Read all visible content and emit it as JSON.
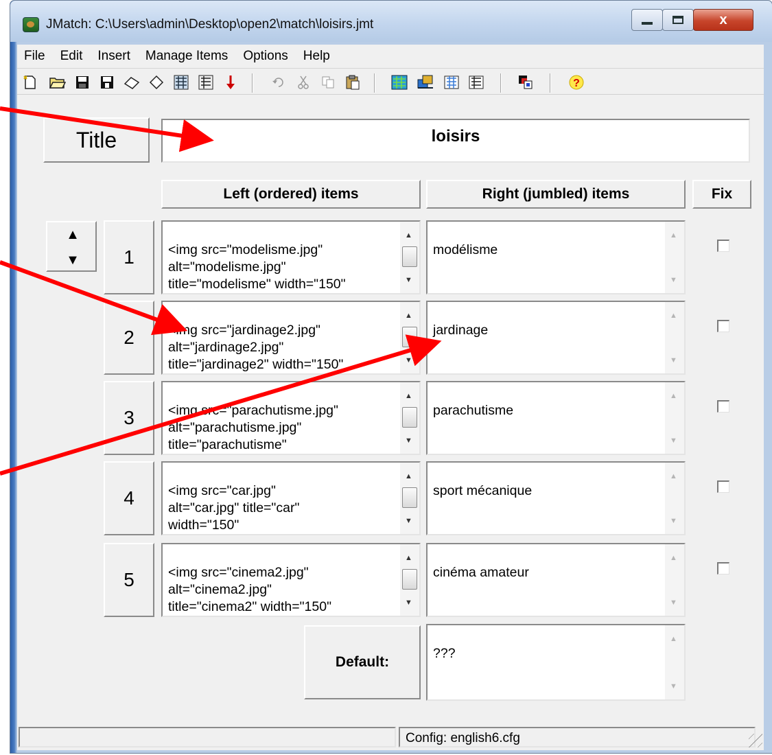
{
  "window": {
    "title": "JMatch: C:\\Users\\admin\\Desktop\\open2\\match\\loisirs.jmt",
    "controls": {
      "minimize": "minimize",
      "maximize": "maximize",
      "close": "x"
    }
  },
  "menu": [
    "File",
    "Edit",
    "Insert",
    "Manage Items",
    "Options",
    "Help"
  ],
  "toolbar": {
    "icons": [
      "new-file-icon",
      "open-folder-icon",
      "save-icon",
      "save-as-icon",
      "eraser-icon",
      "add-exercise-icon",
      "exercise-icon",
      "arrow-down-icon",
      "undo-icon",
      "cut-icon",
      "copy-icon",
      "paste-icon",
      "web-page-icon",
      "export-icon",
      "hotpot-icon",
      "drag-drop-icon",
      "config-icon",
      "help-icon"
    ]
  },
  "title_section": {
    "button_label": "Title",
    "value": "loisirs"
  },
  "headers": {
    "left": "Left (ordered) items",
    "right": "Right (jumbled) items",
    "fix": "Fix"
  },
  "rows": [
    {
      "num": "1",
      "left": "<img src=\"modelisme.jpg\"\nalt=\"modelisme.jpg\"\ntitle=\"modelisme\" width=\"150\"",
      "right": "modélisme",
      "fix": false
    },
    {
      "num": "2",
      "left": "<img src=\"jardinage2.jpg\"\nalt=\"jardinage2.jpg\"\ntitle=\"jardinage2\" width=\"150\"",
      "right": "jardinage",
      "fix": false
    },
    {
      "num": "3",
      "left": "<img src=\"parachutisme.jpg\"\nalt=\"parachutisme.jpg\"\ntitle=\"parachutisme\"",
      "right": "parachutisme",
      "fix": false
    },
    {
      "num": "4",
      "left": "<img src=\"car.jpg\"\nalt=\"car.jpg\" title=\"car\"\nwidth=\"150\"",
      "right": "sport mécanique",
      "fix": false
    },
    {
      "num": "5",
      "left": "<img src=\"cinema2.jpg\"\nalt=\"cinema2.jpg\"\ntitle=\"cinema2\" width=\"150\"",
      "right": "cinéma amateur",
      "fix": false
    }
  ],
  "default": {
    "label": "Default:",
    "value": "???"
  },
  "status": {
    "left": "",
    "right": "Config: english6.cfg"
  },
  "annotation_color": "#ff0000"
}
